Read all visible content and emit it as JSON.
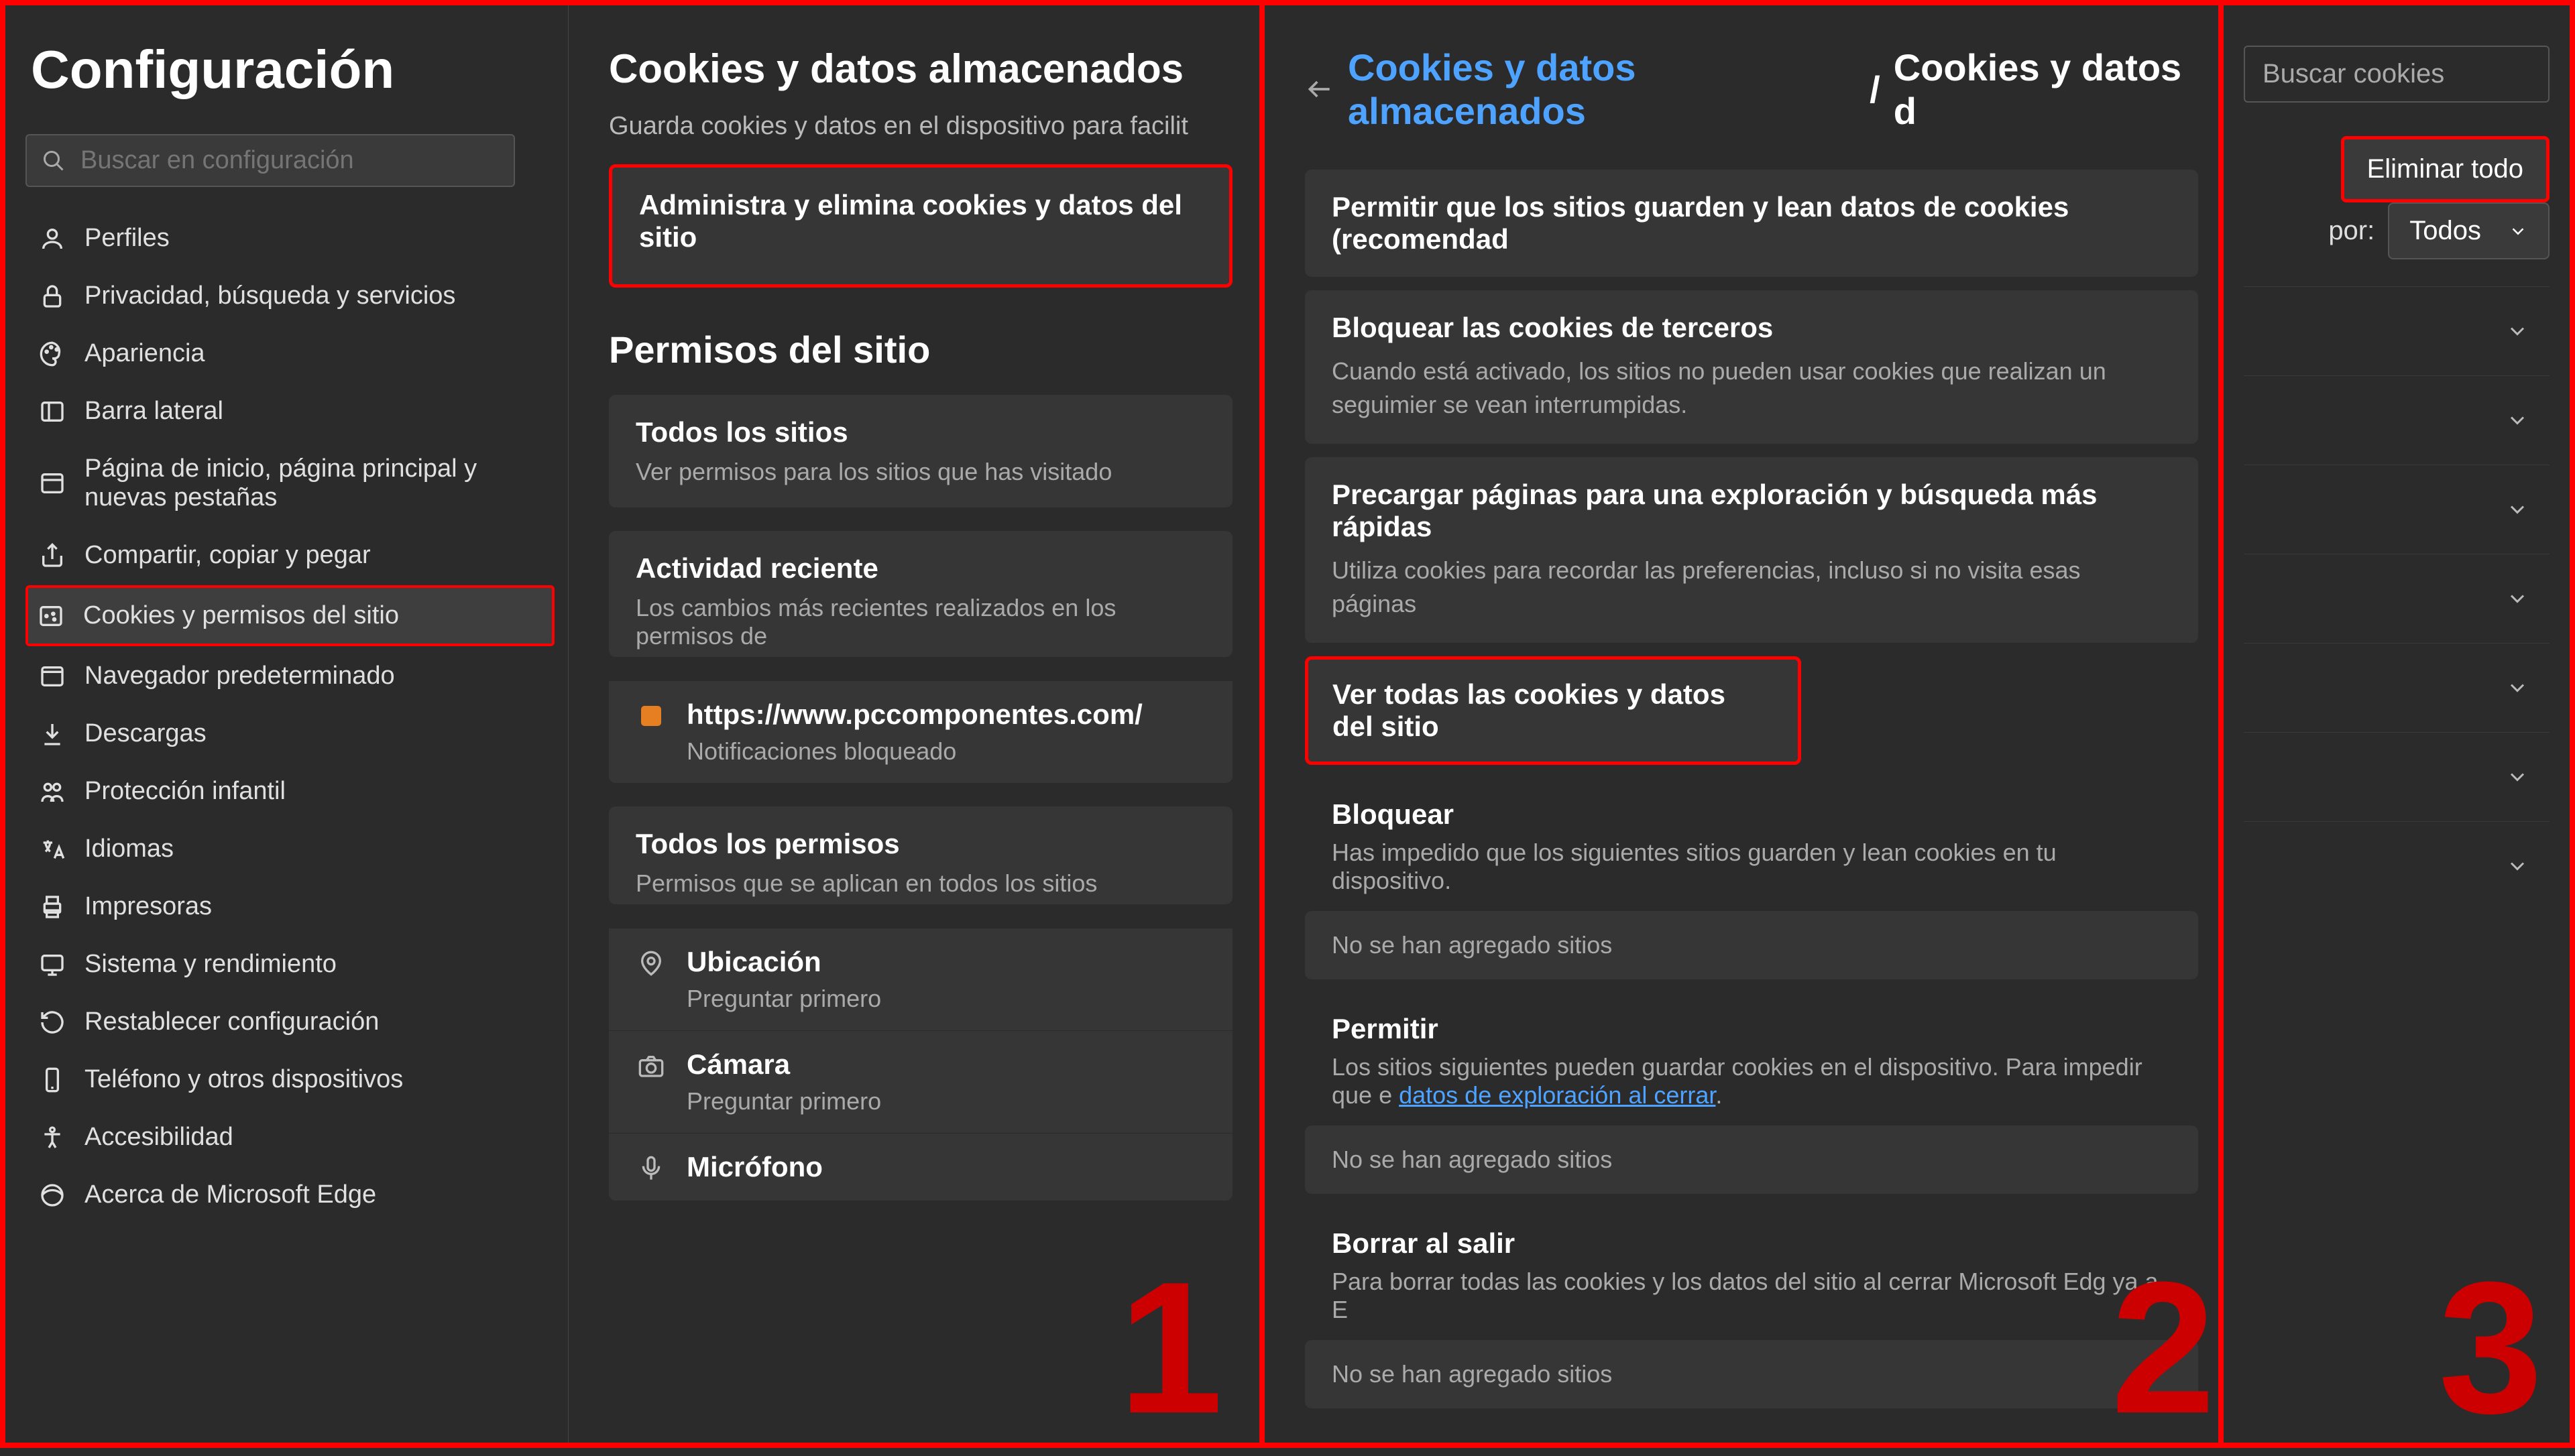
{
  "panel1": {
    "title": "Configuración",
    "search_placeholder": "Buscar en configuración",
    "nav": [
      {
        "label": "Perfiles",
        "icon": "profile-icon"
      },
      {
        "label": "Privacidad, búsqueda y servicios",
        "icon": "lock-icon"
      },
      {
        "label": "Apariencia",
        "icon": "appearance-icon"
      },
      {
        "label": "Barra lateral",
        "icon": "sidebar-icon"
      },
      {
        "label": "Página de inicio, página principal y nuevas pestañas",
        "icon": "home-icon"
      },
      {
        "label": "Compartir, copiar y pegar",
        "icon": "share-icon"
      },
      {
        "label": "Cookies y permisos del sitio",
        "icon": "cookies-icon",
        "active": true
      },
      {
        "label": "Navegador predeterminado",
        "icon": "browser-icon"
      },
      {
        "label": "Descargas",
        "icon": "download-icon"
      },
      {
        "label": "Protección infantil",
        "icon": "family-icon"
      },
      {
        "label": "Idiomas",
        "icon": "languages-icon"
      },
      {
        "label": "Impresoras",
        "icon": "printers-icon"
      },
      {
        "label": "Sistema y rendimiento",
        "icon": "system-icon"
      },
      {
        "label": "Restablecer configuración",
        "icon": "reset-icon"
      },
      {
        "label": "Teléfono y otros dispositivos",
        "icon": "phone-icon"
      },
      {
        "label": "Accesibilidad",
        "icon": "accessibility-icon"
      },
      {
        "label": "Acerca de Microsoft Edge",
        "icon": "edge-icon"
      }
    ],
    "content": {
      "h_cookies": "Cookies y datos almacenados",
      "sub_cookies": "Guarda cookies y datos en el dispositivo para facilit",
      "manage_cookies": "Administra y elimina cookies y datos del sitio",
      "h_perms": "Permisos del sitio",
      "all_sites_title": "Todos los sitios",
      "all_sites_desc": "Ver permisos para los sitios que has visitado",
      "recent_title": "Actividad reciente",
      "recent_desc": "Los cambios más recientes realizados en los permisos de",
      "recent_site": "https://www.pccomponentes.com/",
      "recent_site_status": "Notificaciones bloqueado",
      "all_perms_title": "Todos los permisos",
      "all_perms_desc": "Permisos que se aplican en todos los sitios",
      "perm_location": "Ubicación",
      "perm_location_desc": "Preguntar primero",
      "perm_camera": "Cámara",
      "perm_camera_desc": "Preguntar primero",
      "perm_mic": "Micrófono"
    }
  },
  "panel2": {
    "bc_link": "Cookies y datos almacenados",
    "bc_sep": "/",
    "bc_cur": "Cookies y datos d",
    "s1_title": "Permitir que los sitios guarden y lean datos de cookies (recomendad",
    "s2_title": "Bloquear las cookies de terceros",
    "s2_desc": "Cuando está activado, los sitios no pueden usar cookies que realizan un seguimier se vean interrumpidas.",
    "s3_title": "Precargar páginas para una exploración y búsqueda más rápidas",
    "s3_desc": "Utiliza cookies para recordar las preferencias, incluso si no visita esas páginas",
    "s4_title": "Ver todas las cookies y datos del sitio",
    "block_title": "Bloquear",
    "block_desc": "Has impedido que los siguientes sitios guarden y lean cookies en tu dispositivo.",
    "empty": "No se han agregado sitios",
    "allow_title": "Permitir",
    "allow_desc_pre": "Los sitios siguientes pueden guardar cookies en el dispositivo. Para impedir que e",
    "allow_link": "datos de exploración al cerrar",
    "clear_title": "Borrar al salir",
    "clear_desc": "Para borrar todas las cookies y los datos del sitio al cerrar Microsoft Edg        ya a E"
  },
  "panel3": {
    "search_placeholder": "Buscar cookies",
    "delete_all": "Eliminar todo",
    "filter_label": "por:",
    "filter_value": "Todos"
  },
  "steps": {
    "n1": "1",
    "n2": "2",
    "n3": "3"
  }
}
